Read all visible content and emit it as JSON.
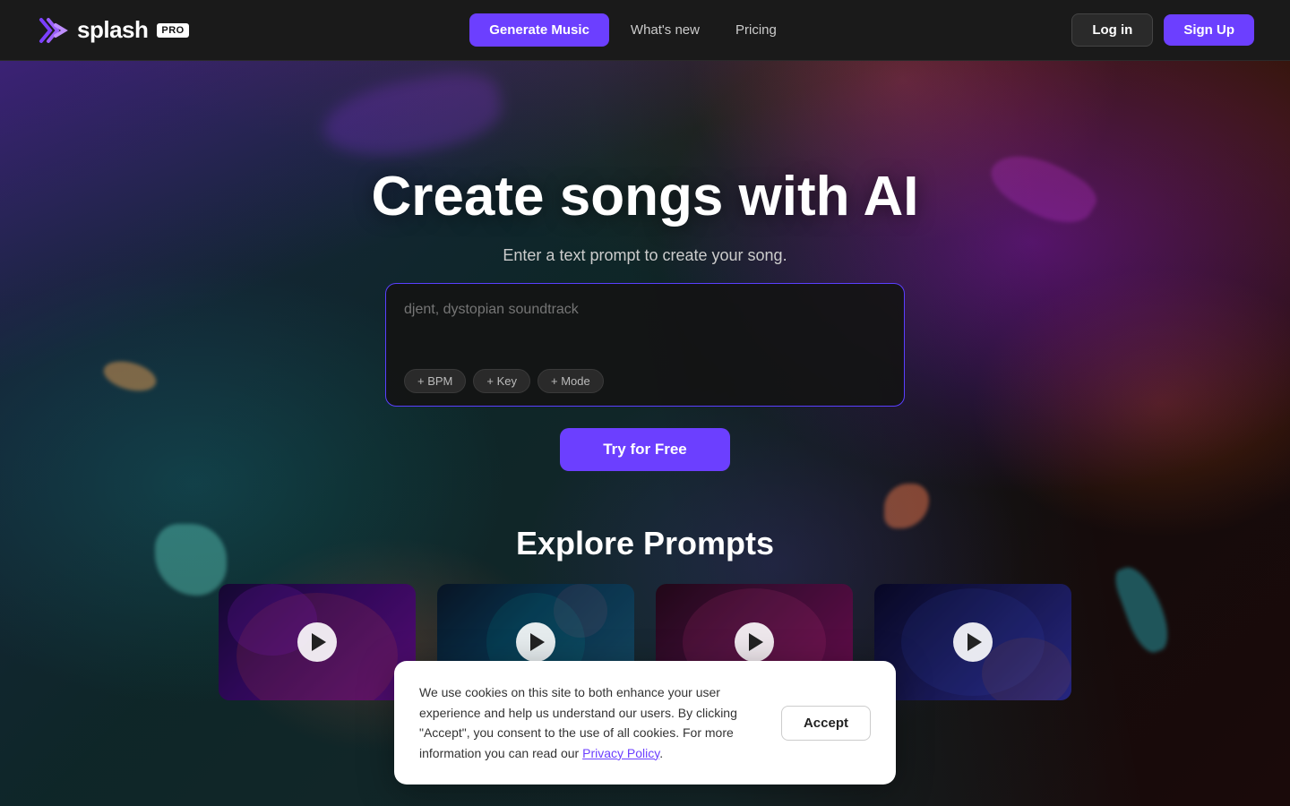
{
  "navbar": {
    "logo_text": "splash",
    "logo_pro": "PRO",
    "generate_label": "Generate Music",
    "whats_new_label": "What's new",
    "pricing_label": "Pricing",
    "login_label": "Log in",
    "signup_label": "Sign Up"
  },
  "hero": {
    "title": "Create songs with AI",
    "subtitle": "Enter a text prompt to create your song.",
    "prompt_placeholder": "djent, dystopian soundtrack",
    "chip_bpm": "+ BPM",
    "chip_key": "+ Key",
    "chip_mode": "+ Mode",
    "cta_label": "Try for Free"
  },
  "explore": {
    "title": "Explore Prompts",
    "cards": [
      {
        "id": "card-1",
        "play_label": "Play"
      },
      {
        "id": "card-2",
        "play_label": "Play"
      },
      {
        "id": "card-3",
        "play_label": "Play"
      },
      {
        "id": "card-4",
        "play_label": "Play"
      }
    ]
  },
  "cookie": {
    "message": "We use cookies on this site to both enhance your user experience and help us understand our users. By clicking \"Accept\", you consent to the use of all cookies. For more information you can read our",
    "link_text": "Privacy Policy",
    "period": ".",
    "accept_label": "Accept"
  }
}
